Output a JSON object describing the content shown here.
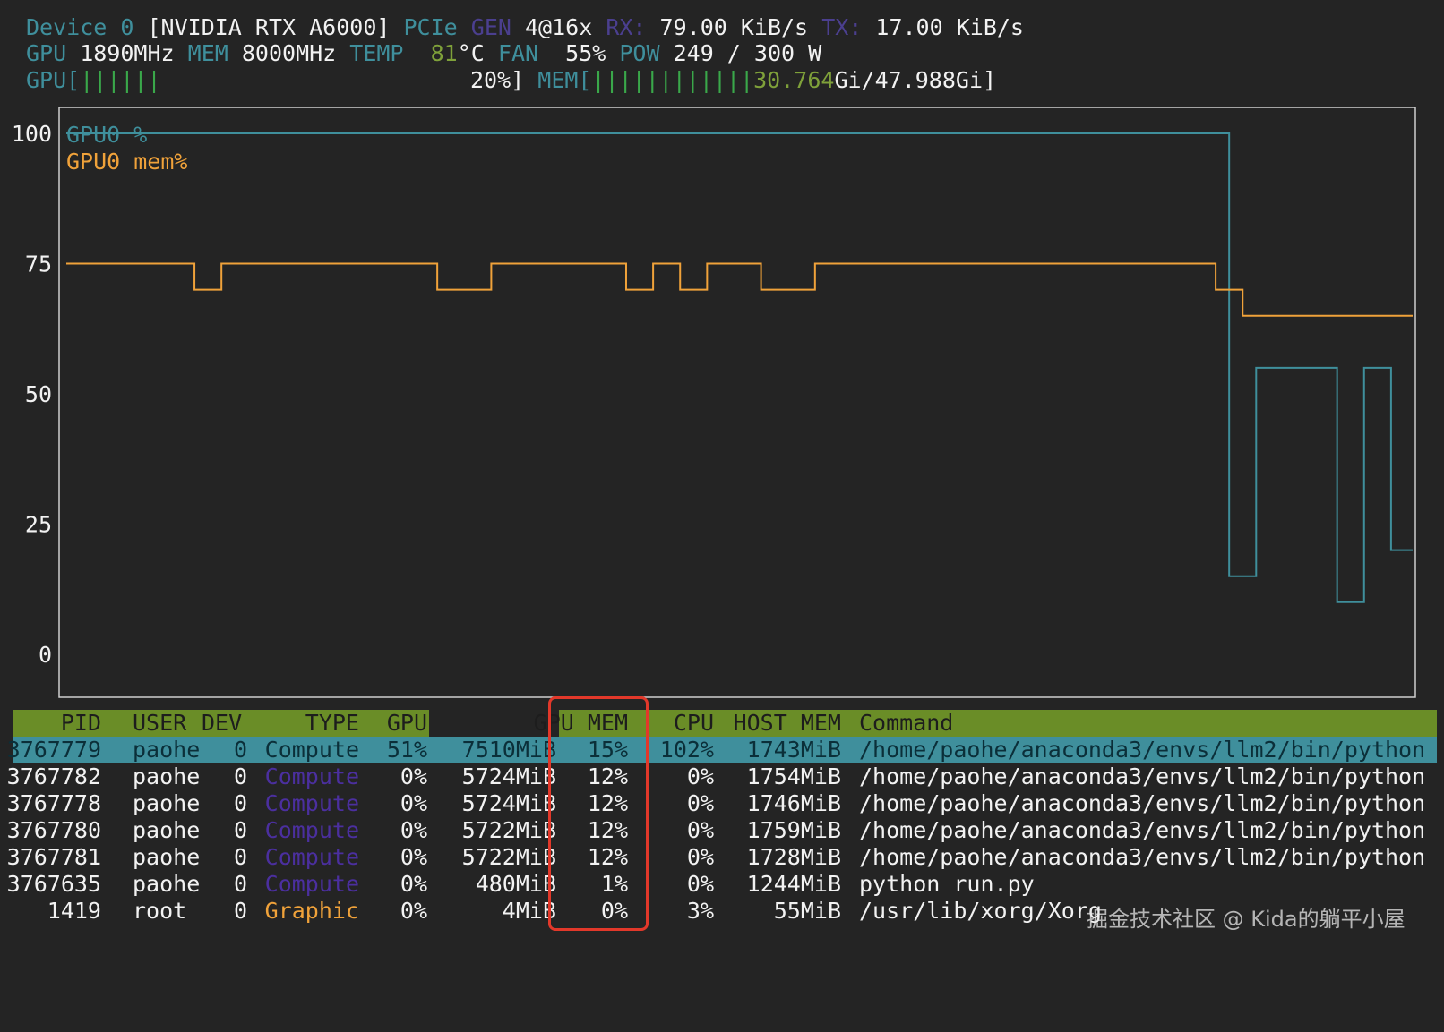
{
  "header": {
    "line1": {
      "device_label": "Device",
      "device_index": "0",
      "device_name": "[NVIDIA RTX A6000]",
      "pcie_label": "PCIe",
      "gen_label": "GEN",
      "gen_value": "4@16x",
      "rx_label": "RX:",
      "rx_value": "79.00 KiB/s",
      "tx_label": "TX:",
      "tx_value": "17.00 KiB/s"
    },
    "line2": {
      "gpu_label": "GPU",
      "gpu_clock": "1890MHz",
      "mem_label": "MEM",
      "mem_clock": "8000MHz",
      "temp_label": "TEMP",
      "temp_value": "81",
      "temp_unit": "°C",
      "fan_label": "FAN",
      "fan_value": "55%",
      "pow_label": "POW",
      "pow_value": "249 / 300 W"
    },
    "line3": {
      "gpu_bar_label": "GPU[",
      "gpu_bar_ticks": "||||||",
      "gpu_bar_value": "20%]",
      "mem_bar_label": "MEM[",
      "mem_bar_ticks": "||||||||||||",
      "mem_used": "30.764",
      "mem_total": "Gi/47.988Gi]"
    }
  },
  "colors": {
    "gpu_line": "#3f8f9c",
    "mem_line": "#f0a23a",
    "header_bg": "#6a8d27",
    "selected_row_bg": "#3f8f9c",
    "highlight_box": "#e2382a"
  },
  "chart_data": {
    "type": "line",
    "ylim": [
      0,
      100
    ],
    "yticks": [
      "100",
      "75",
      "50",
      "25",
      "0"
    ],
    "grid": false,
    "legend_position": "top-left",
    "series": [
      {
        "name": "GPU0 %",
        "color": "#3f8f9c",
        "points": [
          [
            0,
            100
          ],
          [
            86.2,
            100
          ],
          [
            86.2,
            15
          ],
          [
            88.2,
            15
          ],
          [
            88.2,
            55
          ],
          [
            94.2,
            55
          ],
          [
            94.2,
            10
          ],
          [
            96.2,
            10
          ],
          [
            96.2,
            55
          ],
          [
            98.2,
            55
          ],
          [
            98.2,
            20
          ],
          [
            99.8,
            20
          ]
        ]
      },
      {
        "name": "GPU0 mem%",
        "color": "#f0a23a",
        "points": [
          [
            0,
            75
          ],
          [
            9.5,
            75
          ],
          [
            9.5,
            70
          ],
          [
            11.5,
            70
          ],
          [
            11.5,
            75
          ],
          [
            27.5,
            75
          ],
          [
            27.5,
            70
          ],
          [
            31.5,
            70
          ],
          [
            31.5,
            75
          ],
          [
            41.5,
            75
          ],
          [
            41.5,
            70
          ],
          [
            43.5,
            70
          ],
          [
            43.5,
            75
          ],
          [
            45.5,
            75
          ],
          [
            45.5,
            70
          ],
          [
            47.5,
            70
          ],
          [
            47.5,
            75
          ],
          [
            51.5,
            75
          ],
          [
            51.5,
            70
          ],
          [
            55.5,
            70
          ],
          [
            55.5,
            75
          ],
          [
            85.2,
            75
          ],
          [
            85.2,
            70
          ],
          [
            87.2,
            70
          ],
          [
            87.2,
            65
          ],
          [
            99.8,
            65
          ]
        ]
      }
    ]
  },
  "table": {
    "columns": [
      "PID",
      "USER",
      "DEV",
      "TYPE",
      "GPU",
      "GPU MEM",
      "",
      "CPU",
      "HOST MEM",
      "Command"
    ],
    "rows": [
      {
        "pid": "3767779",
        "user": "paohe",
        "dev": "0",
        "type": "Compute",
        "gpu": "51%",
        "gpu_mem": "7510MiB",
        "mem_pct": "15%",
        "cpu": "102%",
        "host_mem": "1743MiB",
        "command": "/home/paohe/anaconda3/envs/llm2/bin/python",
        "selected": true
      },
      {
        "pid": "3767782",
        "user": "paohe",
        "dev": "0",
        "type": "Compute",
        "gpu": "0%",
        "gpu_mem": "5724MiB",
        "mem_pct": "12%",
        "cpu": "0%",
        "host_mem": "1754MiB",
        "command": "/home/paohe/anaconda3/envs/llm2/bin/python",
        "selected": false
      },
      {
        "pid": "3767778",
        "user": "paohe",
        "dev": "0",
        "type": "Compute",
        "gpu": "0%",
        "gpu_mem": "5724MiB",
        "mem_pct": "12%",
        "cpu": "0%",
        "host_mem": "1746MiB",
        "command": "/home/paohe/anaconda3/envs/llm2/bin/python",
        "selected": false
      },
      {
        "pid": "3767780",
        "user": "paohe",
        "dev": "0",
        "type": "Compute",
        "gpu": "0%",
        "gpu_mem": "5722MiB",
        "mem_pct": "12%",
        "cpu": "0%",
        "host_mem": "1759MiB",
        "command": "/home/paohe/anaconda3/envs/llm2/bin/python",
        "selected": false
      },
      {
        "pid": "3767781",
        "user": "paohe",
        "dev": "0",
        "type": "Compute",
        "gpu": "0%",
        "gpu_mem": "5722MiB",
        "mem_pct": "12%",
        "cpu": "0%",
        "host_mem": "1728MiB",
        "command": "/home/paohe/anaconda3/envs/llm2/bin/python",
        "selected": false
      },
      {
        "pid": "3767635",
        "user": "paohe",
        "dev": "0",
        "type": "Compute",
        "gpu": "0%",
        "gpu_mem": "480MiB",
        "mem_pct": "1%",
        "cpu": "0%",
        "host_mem": "1244MiB",
        "command": "python run.py",
        "selected": false
      },
      {
        "pid": "1419",
        "user": "root",
        "dev": "0",
        "type": "Graphic",
        "gpu": "0%",
        "gpu_mem": "4MiB",
        "mem_pct": "0%",
        "cpu": "3%",
        "host_mem": "55MiB",
        "command": "/usr/lib/xorg/Xorg",
        "selected": false
      }
    ]
  },
  "watermark": "掘金技术社区 @ Kida的躺平小屋"
}
